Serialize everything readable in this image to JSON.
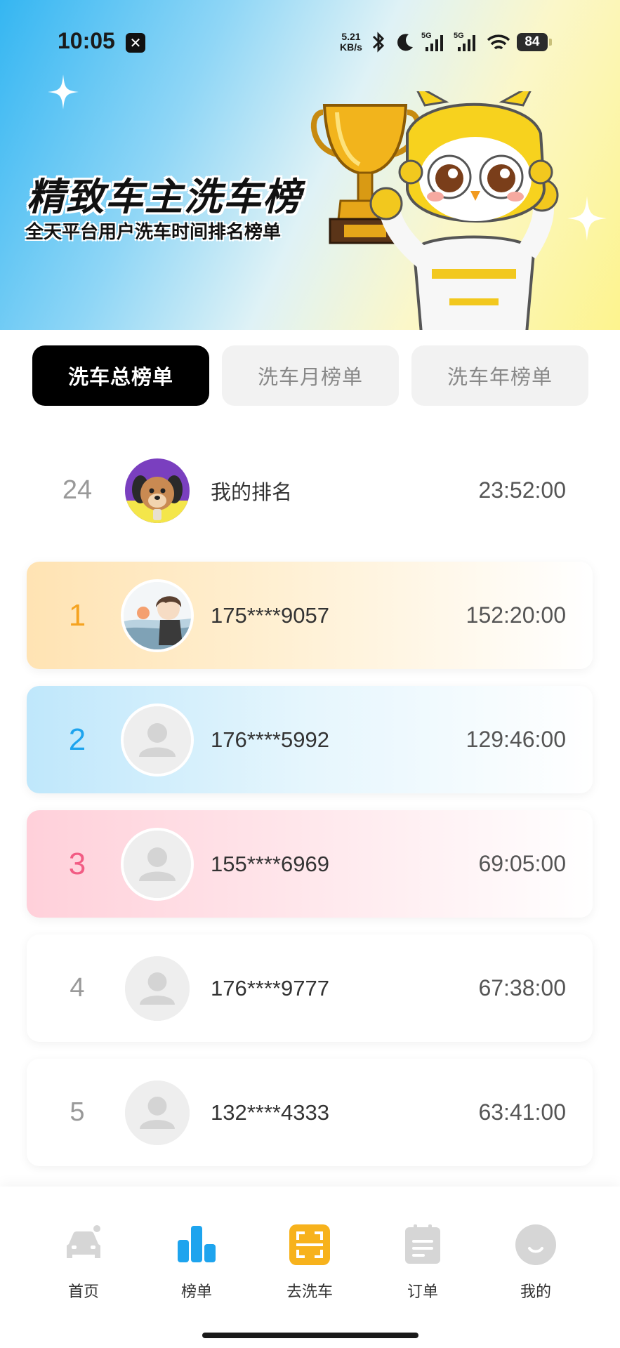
{
  "status_bar": {
    "time": "10:05",
    "app_badge": "✕",
    "net_speed_value": "5.21",
    "net_speed_unit": "KB/s",
    "battery": "84"
  },
  "banner": {
    "title": "精致车主洗车榜",
    "subtitle": "全天平台用户洗车时间排名榜单"
  },
  "tabs": [
    {
      "label": "洗车总榜单",
      "active": true
    },
    {
      "label": "洗车月榜单",
      "active": false
    },
    {
      "label": "洗车年榜单",
      "active": false
    }
  ],
  "my_rank": {
    "rank": "24",
    "name": "我的排名",
    "time": "23:52:00"
  },
  "leaderboard": [
    {
      "rank": "1",
      "name": "175****9057",
      "time": "152:20:00"
    },
    {
      "rank": "2",
      "name": "176****5992",
      "time": "129:46:00"
    },
    {
      "rank": "3",
      "name": "155****6969",
      "time": "69:05:00"
    },
    {
      "rank": "4",
      "name": "176****9777",
      "time": "67:38:00"
    },
    {
      "rank": "5",
      "name": "132****4333",
      "time": "63:41:00"
    }
  ],
  "bottom_nav": [
    {
      "label": "首页",
      "icon": "car-icon",
      "active": false
    },
    {
      "label": "榜单",
      "icon": "bar-chart-icon",
      "active": true
    },
    {
      "label": "去洗车",
      "icon": "scan-icon",
      "active": false
    },
    {
      "label": "订单",
      "icon": "clipboard-icon",
      "active": false
    },
    {
      "label": "我的",
      "icon": "profile-icon",
      "active": false
    }
  ],
  "colors": {
    "rank1": "#f5a321",
    "rank2": "#1ea4ee",
    "rank3": "#f25c84",
    "nav_active": "#1ea4ee",
    "scan_button": "#f7b21c"
  }
}
